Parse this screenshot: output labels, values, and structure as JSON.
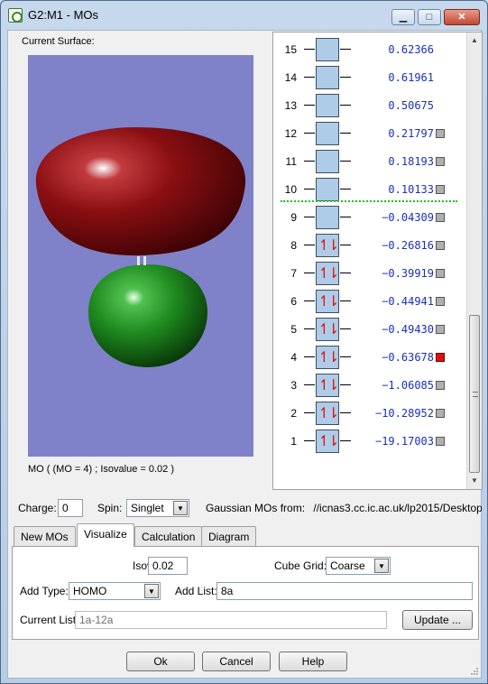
{
  "window": {
    "title": "G2:M1 - MOs",
    "buttons": {
      "minimize": "▁",
      "maximize": "□",
      "close": "✕"
    }
  },
  "surface": {
    "header": "Current Surface:",
    "caption": "MO ( (MO = 4) ; Isovalue = 0.02 )",
    "colors": {
      "background": "#7f82c8",
      "positive_lobe": "#8a0f12",
      "negative_lobe": "#1f8a1f"
    }
  },
  "mo_list": [
    {
      "n": "15",
      "energy": "0.62366",
      "occupied": false,
      "checkbox": false,
      "selected": false
    },
    {
      "n": "14",
      "energy": "0.61961",
      "occupied": false,
      "checkbox": false,
      "selected": false
    },
    {
      "n": "13",
      "energy": "0.50675",
      "occupied": false,
      "checkbox": false,
      "selected": false
    },
    {
      "n": "12",
      "energy": "0.21797",
      "occupied": false,
      "checkbox": true,
      "selected": false
    },
    {
      "n": "11",
      "energy": "0.18193",
      "occupied": false,
      "checkbox": true,
      "selected": false
    },
    {
      "n": "10",
      "energy": "0.10133",
      "occupied": false,
      "checkbox": true,
      "selected": false
    },
    {
      "n": "9",
      "energy": "−0.04309",
      "occupied": false,
      "checkbox": true,
      "selected": false
    },
    {
      "n": "8",
      "energy": "−0.26816",
      "occupied": true,
      "checkbox": true,
      "selected": false
    },
    {
      "n": "7",
      "energy": "−0.39919",
      "occupied": true,
      "checkbox": true,
      "selected": false
    },
    {
      "n": "6",
      "energy": "−0.44941",
      "occupied": true,
      "checkbox": true,
      "selected": false
    },
    {
      "n": "5",
      "energy": "−0.49430",
      "occupied": true,
      "checkbox": true,
      "selected": false
    },
    {
      "n": "4",
      "energy": "−0.63678",
      "occupied": true,
      "checkbox": true,
      "selected": true
    },
    {
      "n": "3",
      "energy": "−1.06085",
      "occupied": true,
      "checkbox": true,
      "selected": false
    },
    {
      "n": "2",
      "energy": "−10.28952",
      "occupied": true,
      "checkbox": true,
      "selected": false
    },
    {
      "n": "1",
      "energy": "−19.17003",
      "occupied": true,
      "checkbox": true,
      "selected": false
    }
  ],
  "electron_glyph": "↿⇂",
  "settings": {
    "charge_label": "Charge:",
    "charge_value": "0",
    "spin_label": "Spin:",
    "spin_value": "Singlet",
    "gaussian_label": "Gaussian MOs from:",
    "gaussian_path": "//icnas3.cc.ic.ac.uk/lp2015/Desktop"
  },
  "tabs": [
    "New MOs",
    "Visualize",
    "Calculation",
    "Diagram"
  ],
  "active_tab": "Visualize",
  "visualize": {
    "isovalue_label": "Isovalue:",
    "isovalue": "0.02",
    "cube_grid_label": "Cube Grid:",
    "cube_grid": "Coarse",
    "add_type_label": "Add Type:",
    "add_type": "HOMO",
    "add_list_label": "Add List:",
    "add_list": "8a",
    "current_list_label": "Current List:",
    "current_list": "1a-12a",
    "update_button": "Update ..."
  },
  "footer": {
    "ok": "Ok",
    "cancel": "Cancel",
    "help": "Help"
  },
  "colors": {
    "energy_text": "#1a30b8",
    "orbital_box": "#aecbe8",
    "homo_lumo_separator": "#19c419",
    "selected_check": "#e01010"
  }
}
